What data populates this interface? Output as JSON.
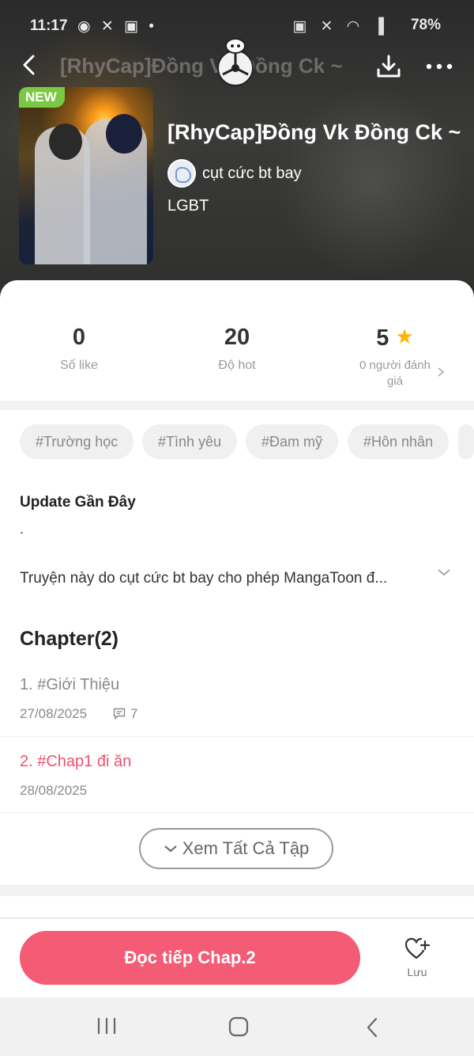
{
  "status_bar": {
    "time": "11:17",
    "notif_icons": "messenger-icon capcut-icon gallery-icon dot-icon",
    "battery": "78%"
  },
  "topbar": {
    "title": "[RhyCap]Đồng Vk Đồng Ck ~"
  },
  "book": {
    "badge": "NEW",
    "title": "[RhyCap]Đồng Vk Đồng Ck ~",
    "author": "cụt cức bt bay",
    "category": "LGBT"
  },
  "stats": {
    "likes": "0",
    "likes_label": "Số like",
    "hot": "20",
    "hot_label": "Độ hot",
    "rating": "5",
    "rating_label": "0 người đánh giá"
  },
  "tags": [
    "#Trường học",
    "#Tình yêu",
    "#Đam mỹ",
    "#Hôn nhân"
  ],
  "info": {
    "update_title": "Update Gần Đây",
    "update_text": ".",
    "description": "Truyện này do cụt cức bt bay cho phép MangaToon đ..."
  },
  "chapters": {
    "title": "Chapter(2)",
    "items": [
      {
        "title": "1. #Giới Thiệu",
        "date": "27/08/2025",
        "comments": "7"
      },
      {
        "title": "2. #Chap1 đi ăn",
        "date": "28/08/2025"
      }
    ],
    "see_all": "Xem Tất Cả Tập"
  },
  "bottom": {
    "read_button": "Đọc tiếp Chap.2",
    "save_label": "Lưu"
  },
  "colors": {
    "accent": "#f45b75",
    "badge": "#7ac943",
    "star": "#ffb400"
  }
}
